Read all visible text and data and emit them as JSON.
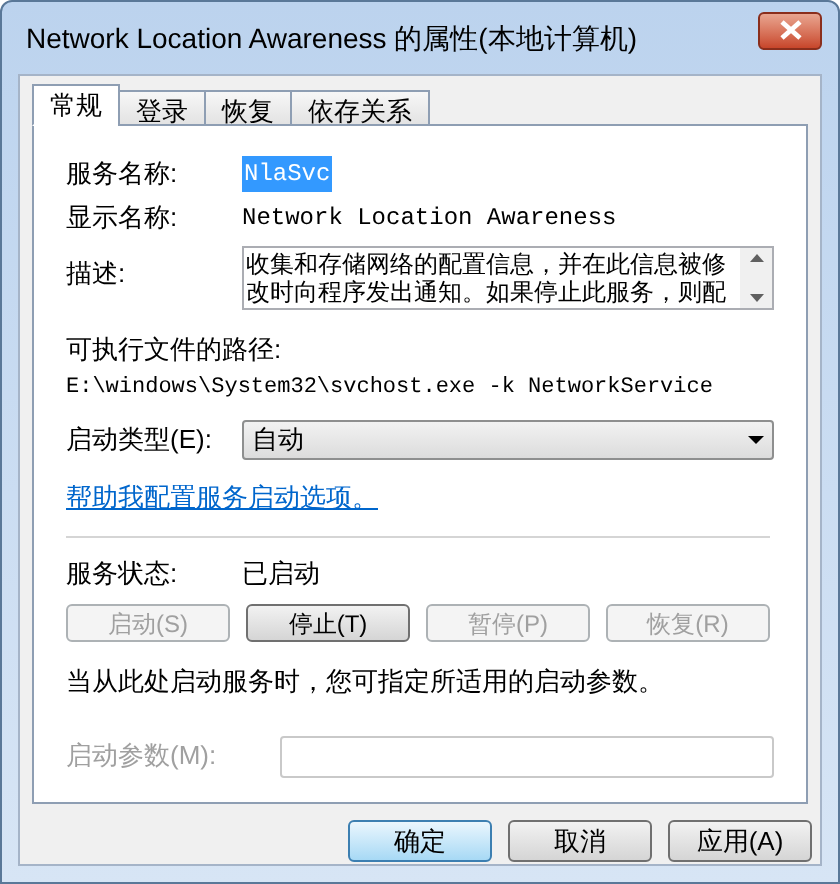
{
  "window": {
    "title": "Network Location Awareness 的属性(本地计算机)"
  },
  "tabs": [
    {
      "label": "常规",
      "selected": true
    },
    {
      "label": "登录",
      "selected": false
    },
    {
      "label": "恢复",
      "selected": false
    },
    {
      "label": "依存关系",
      "selected": false
    }
  ],
  "service_name": {
    "label": "服务名称:",
    "value": "NlaSvc",
    "selected": true
  },
  "display_name": {
    "label": "显示名称:",
    "value": "Network Location Awareness"
  },
  "description": {
    "label": "描述:",
    "lines": [
      "收集和存储网络的配置信息，并在此信息被修",
      "改时向程序发出通知。如果停止此服务，则配"
    ]
  },
  "executable_path": {
    "label": "可执行文件的路径:",
    "value": "E:\\windows\\System32\\svchost.exe -k NetworkService"
  },
  "startup_type": {
    "label": "启动类型(E):",
    "value": "自动"
  },
  "help_link": "帮助我配置服务启动选项。",
  "service_status": {
    "label": "服务状态:",
    "value": "已启动"
  },
  "service_buttons": [
    {
      "label": "启动(S)",
      "disabled": true
    },
    {
      "label": "停止(T)",
      "disabled": false
    },
    {
      "label": "暂停(P)",
      "disabled": true
    },
    {
      "label": "恢复(R)",
      "disabled": true
    }
  ],
  "start_hint": "当从此处启动服务时，您可指定所适用的启动参数。",
  "start_parameters": {
    "label": "启动参数(M):",
    "disabled": true
  },
  "dialog_buttons": [
    {
      "label": "确定",
      "default": true
    },
    {
      "label": "取消",
      "default": false
    },
    {
      "label": "应用(A)",
      "default": false
    }
  ]
}
